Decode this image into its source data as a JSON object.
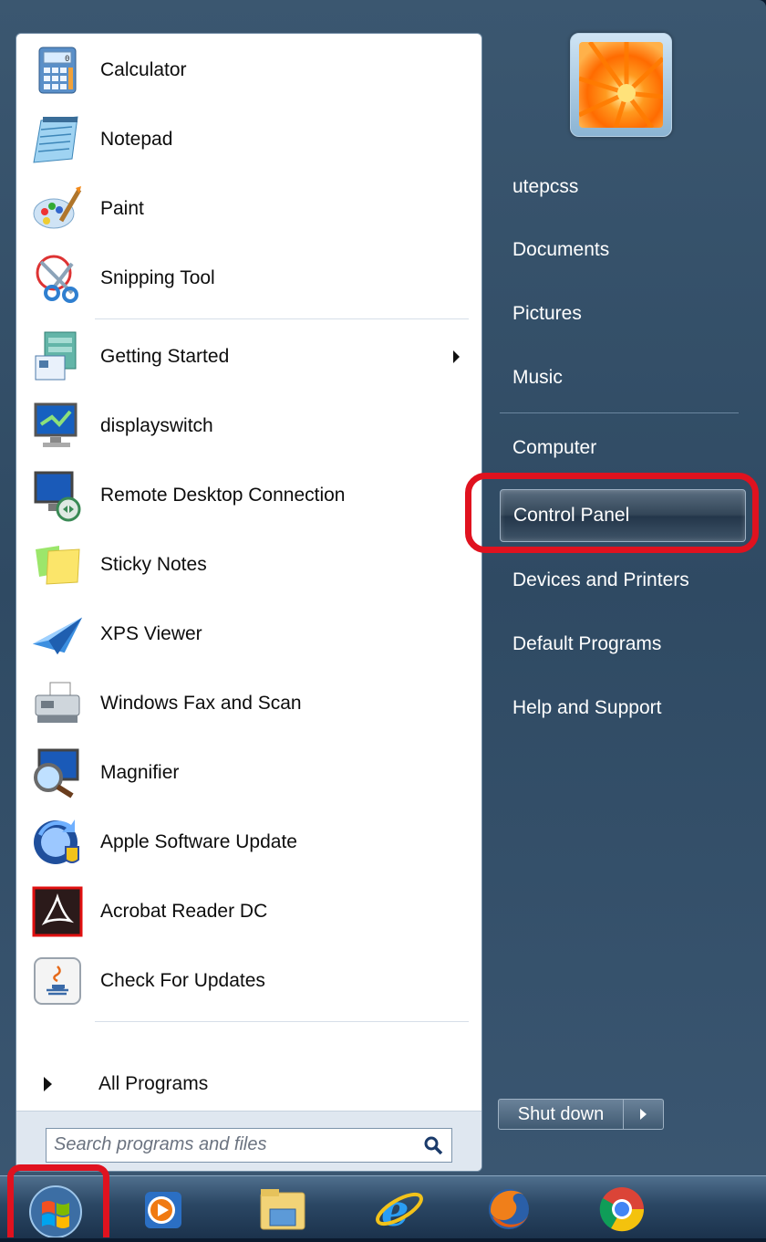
{
  "programs": [
    {
      "label": "Calculator",
      "icon": "calculator-icon"
    },
    {
      "label": "Notepad",
      "icon": "notepad-icon"
    },
    {
      "label": "Paint",
      "icon": "paint-icon"
    },
    {
      "label": "Snipping Tool",
      "icon": "snipping-tool-icon"
    },
    {
      "label": "Getting Started",
      "icon": "getting-started-icon",
      "has_submenu": true
    },
    {
      "label": "displayswitch",
      "icon": "displayswitch-icon"
    },
    {
      "label": "Remote Desktop Connection",
      "icon": "remote-desktop-icon"
    },
    {
      "label": "Sticky Notes",
      "icon": "sticky-notes-icon"
    },
    {
      "label": "XPS Viewer",
      "icon": "xps-viewer-icon"
    },
    {
      "label": "Windows Fax and Scan",
      "icon": "fax-scan-icon"
    },
    {
      "label": "Magnifier",
      "icon": "magnifier-icon"
    },
    {
      "label": "Apple Software Update",
      "icon": "apple-update-icon"
    },
    {
      "label": "Acrobat Reader DC",
      "icon": "acrobat-icon"
    },
    {
      "label": "Check For Updates",
      "icon": "java-update-icon"
    }
  ],
  "all_programs_label": "All Programs",
  "search": {
    "placeholder": "Search programs and files"
  },
  "right_links": [
    {
      "label": "utepcss"
    },
    {
      "label": "Documents"
    },
    {
      "label": "Pictures"
    },
    {
      "label": "Music"
    },
    {
      "label": "Computer"
    },
    {
      "label": "Control Panel",
      "selected": true
    },
    {
      "label": "Devices and Printers"
    },
    {
      "label": "Default Programs"
    },
    {
      "label": "Help and Support"
    }
  ],
  "shutdown_label": "Shut down",
  "taskbar_icons": [
    "windows-media-player-icon",
    "file-explorer-icon",
    "internet-explorer-icon",
    "firefox-icon",
    "chrome-icon"
  ],
  "colors": {
    "highlight": "#e0121f"
  }
}
